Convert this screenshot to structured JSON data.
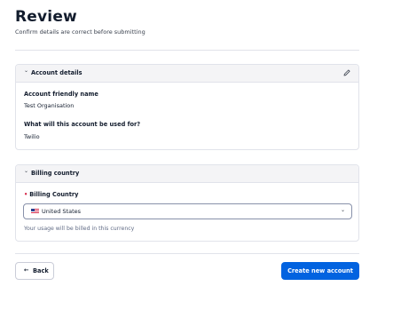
{
  "page": {
    "title": "Review",
    "subtitle": "Confirm details are correct before submitting"
  },
  "account_details": {
    "header": "Account details",
    "friendly_name_label": "Account friendly name",
    "friendly_name_value": "Test Organisation",
    "usage_label": "What will this account be used for?",
    "usage_value": "Twilio"
  },
  "billing": {
    "header": "Billing country",
    "required_marker": "•",
    "country_label": "Billing Country",
    "country_value": "United States",
    "help_text": "Your usage will be billed in this currency"
  },
  "actions": {
    "back_label": "Back",
    "back_arrow": "←",
    "create_label": "Create new account"
  },
  "colors": {
    "primary": "#0263e0",
    "required": "#d6294a",
    "header_bg": "#f4f4f6"
  }
}
